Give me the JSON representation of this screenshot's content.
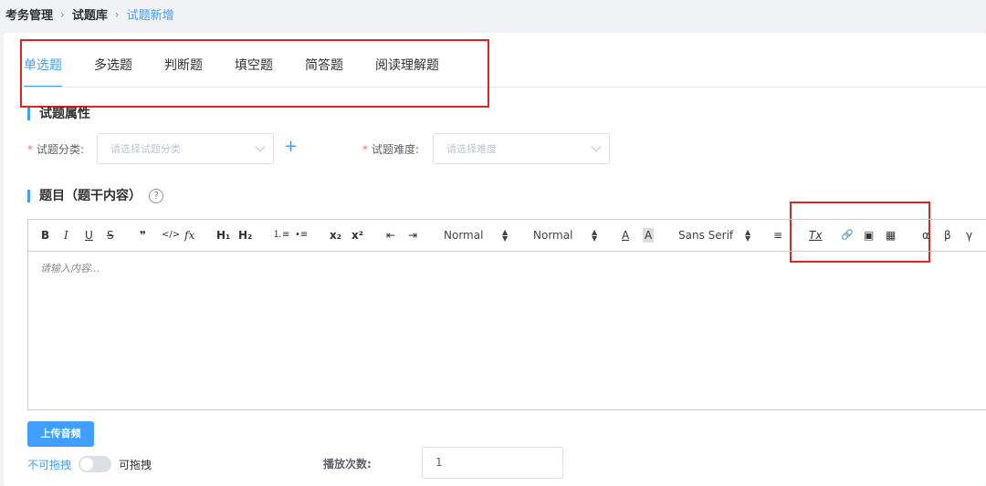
{
  "breadcrumb": [
    "考务管理",
    "试题库",
    "试题新增"
  ],
  "tabs": [
    "单选题",
    "多选题",
    "判断题",
    "填空题",
    "简答题",
    "阅读理解题"
  ],
  "section_attrs": "试题属性",
  "category": {
    "label": "试题分类:",
    "placeholder": "请选择试题分类"
  },
  "difficulty": {
    "label": "试题难度:",
    "placeholder": "请选择难度"
  },
  "section_content": "题目（题干内容）",
  "help_icon": "?",
  "toolbar": {
    "bold": "B",
    "italic": "I",
    "underline": "U",
    "strike": "S",
    "quote": "❞",
    "code": "</>",
    "formula": "fx",
    "h1": "H₁",
    "h2": "H₂",
    "ordered": "⒈≡",
    "bullet": "•≡",
    "sub": "x₂",
    "sup": "x²",
    "outdent": "⇤",
    "indent": "⇥",
    "size": "Normal",
    "header": "Normal",
    "color": "A",
    "background": "A",
    "font": "Sans Serif",
    "align": "≡",
    "clean": "Tx",
    "link": "🔗",
    "image": "▣",
    "video": "▦",
    "alpha": "α",
    "beta": "β",
    "gamma": "γ"
  },
  "editor_placeholder": "请输入内容...",
  "upload_button": "上传音频",
  "drag_off": "不可拖拽",
  "drag_on": "可拖拽",
  "play_label": "播放次数:",
  "play_count": "1"
}
